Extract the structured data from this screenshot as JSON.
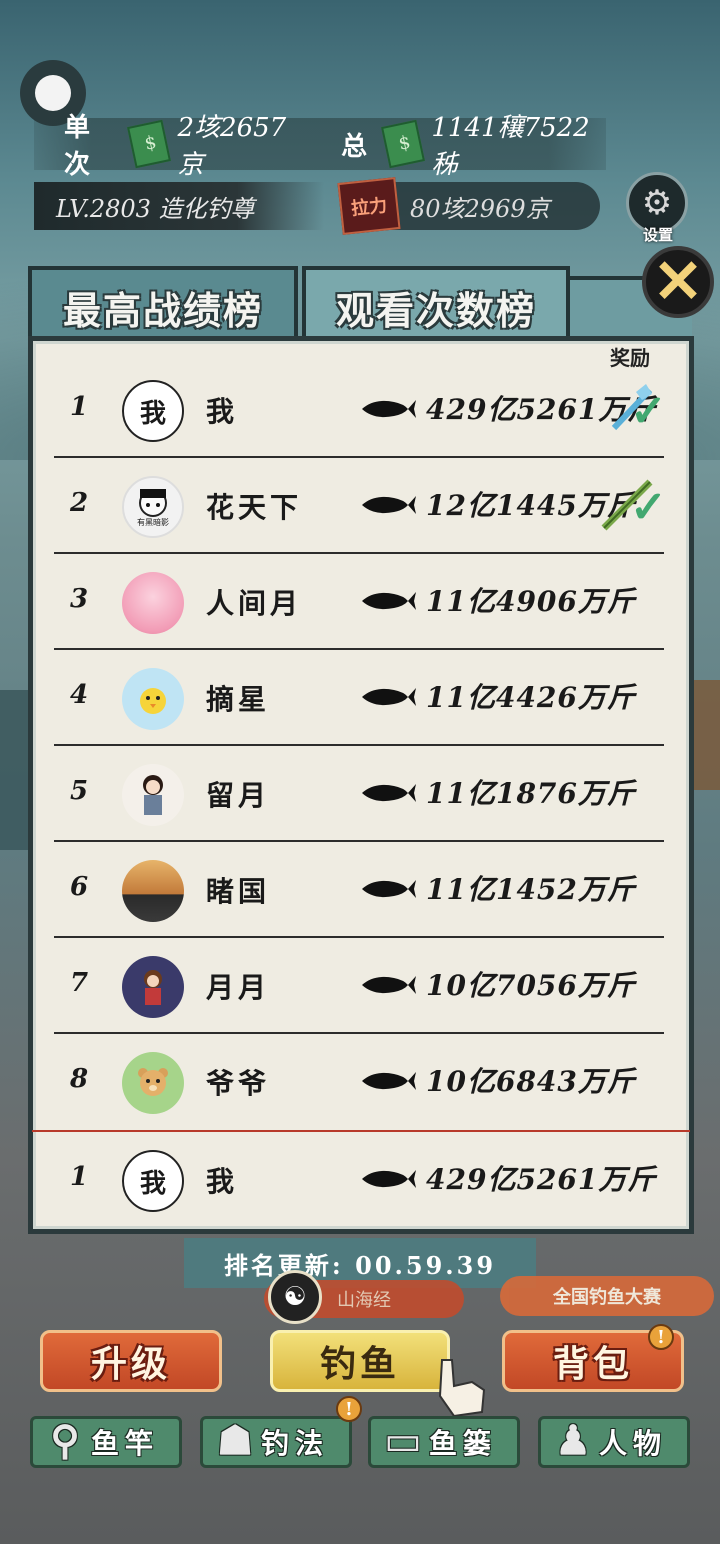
{
  "header": {
    "single_label": "单次",
    "single_value": "2垓2657京",
    "total_label": "总",
    "total_value": "1141穰7522秭",
    "level_text": "LV.2803 造化钓尊",
    "power_badge": "拉力",
    "power_value": "80垓2969京",
    "settings_label": "设置"
  },
  "tabs": [
    {
      "label": "最高战绩榜",
      "active": false
    },
    {
      "label": "观看次数榜",
      "active": true
    }
  ],
  "panel": {
    "reward_label": "奖励",
    "rows": [
      {
        "rank": "1",
        "avatar_text": "我",
        "name": "我",
        "score": "429亿5261万斤"
      },
      {
        "rank": "2",
        "avatar_text": "",
        "name": "花天下",
        "score": "12亿1445万斤"
      },
      {
        "rank": "3",
        "avatar_text": "",
        "name": "人间月",
        "score": "11亿4906万斤"
      },
      {
        "rank": "4",
        "avatar_text": "",
        "name": "摘星",
        "score": "11亿4426万斤"
      },
      {
        "rank": "5",
        "avatar_text": "",
        "name": "留月",
        "score": "11亿1876万斤"
      },
      {
        "rank": "6",
        "avatar_text": "",
        "name": "睹国",
        "score": "11亿1452万斤"
      },
      {
        "rank": "7",
        "avatar_text": "",
        "name": "月月",
        "score": "10亿7056万斤"
      },
      {
        "rank": "8",
        "avatar_text": "",
        "name": "爷爷",
        "score": "10亿6843万斤"
      }
    ],
    "my_row": {
      "rank": "1",
      "avatar_text": "我",
      "name": "我",
      "score": "429亿5261万斤"
    },
    "row2_avatar_caption": "有黑暗影"
  },
  "timer": {
    "text": "排名更新: 00.59.39"
  },
  "events": {
    "left": "山海经",
    "right": "全国钓鱼大赛",
    "left_icon": "☯"
  },
  "main_buttons": [
    {
      "label": "升级"
    },
    {
      "label": "钓鱼"
    },
    {
      "label": "背包"
    }
  ],
  "nav_buttons": [
    {
      "label": "鱼竿",
      "icon": "rod-icon"
    },
    {
      "label": "钓法",
      "icon": "technique-icon"
    },
    {
      "label": "鱼篓",
      "icon": "basket-icon"
    },
    {
      "label": "人物",
      "icon": "character-icon"
    }
  ],
  "colors": {
    "panel_bg": "#efece2",
    "tab_active": "#7aa8ac",
    "check": "#42a870",
    "divider_red": "#b83a2a"
  }
}
